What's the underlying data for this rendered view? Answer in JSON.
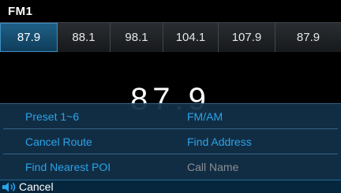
{
  "header": {
    "title": "FM1"
  },
  "presets": [
    {
      "label": "87.9",
      "active": true
    },
    {
      "label": "88.1",
      "active": false
    },
    {
      "label": "98.1",
      "active": false
    },
    {
      "label": "104.1",
      "active": false
    },
    {
      "label": "107.9",
      "active": false
    },
    {
      "label": "87.9",
      "active": false
    }
  ],
  "display": {
    "frequency": "87.9"
  },
  "voice_commands": {
    "preset": "Preset 1~6",
    "fm_am": "FM/AM",
    "cancel_route": "Cancel Route",
    "find_address": "Find Address",
    "find_nearest_poi": "Find Nearest POI",
    "call_name": "Call Name"
  },
  "footer": {
    "cancel_label": "Cancel",
    "icon": "speaker-icon"
  },
  "colors": {
    "accent": "#2aa3e8",
    "overlay": "#123048",
    "active_tab": "#1f5f86",
    "disabled": "#8c8f93"
  }
}
